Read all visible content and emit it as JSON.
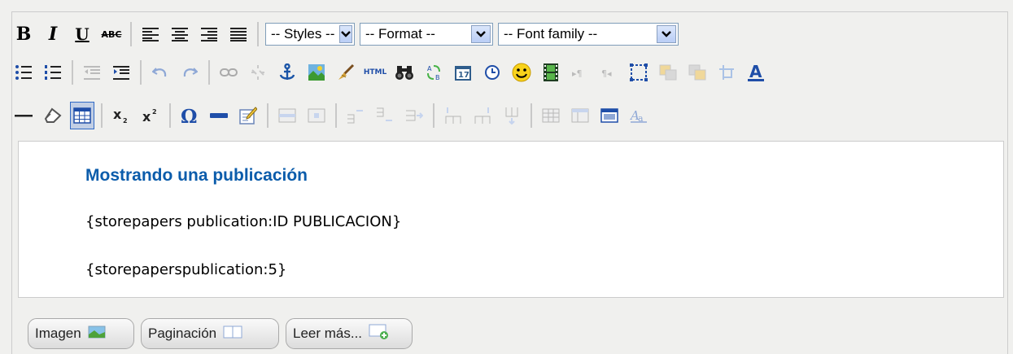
{
  "toolbar": {
    "bold_label": "B",
    "italic_label": "I",
    "underline_label": "U",
    "strike_label": "ABC",
    "html_label": "HTML",
    "styles_select": "-- Styles --",
    "format_select": "-- Format --",
    "font_select": "-- Font family --"
  },
  "content": {
    "heading": "Mostrando una publicación",
    "line1": "{storepapers publication:ID PUBLICACION}",
    "line2": "{storepaperspublication:5}"
  },
  "buttons": {
    "image": "Imagen",
    "pagebreak": "Paginación",
    "readmore": "Leer más..."
  },
  "colors": {
    "heading": "#0b5cab",
    "active_button_border": "#316ac5",
    "active_button_bg": "#c2cfe5",
    "select_border": "#7f9db9"
  }
}
